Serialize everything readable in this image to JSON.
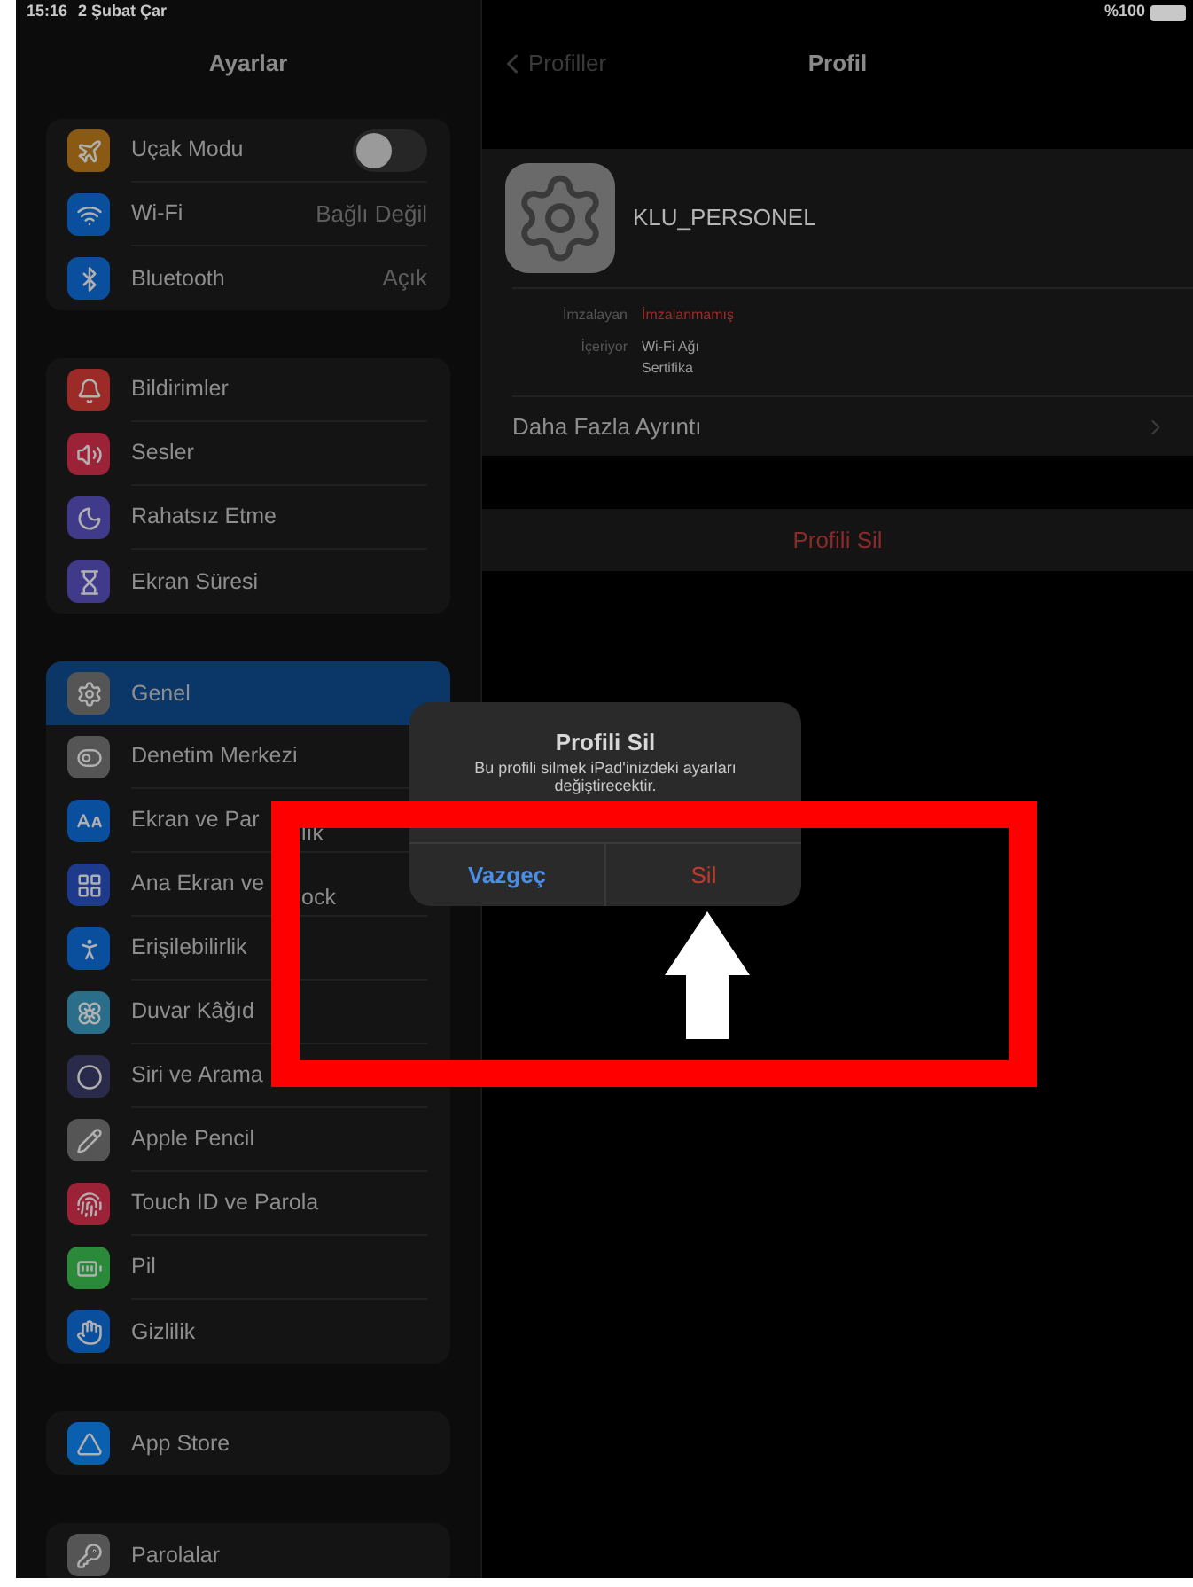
{
  "status_bar": {
    "time": "15:16",
    "date": "2 Şubat Çar",
    "battery": "%100"
  },
  "sidebar": {
    "title": "Ayarlar",
    "groups": [
      {
        "items": [
          {
            "label": "Uçak Modu",
            "kind": "toggle",
            "on": false,
            "selected": false,
            "color": "#8a5a14"
          },
          {
            "label": "Wi-Fi",
            "kind": "value",
            "value": "Bağlı Değil",
            "selected": false,
            "color": "#0a4f9e"
          },
          {
            "label": "Bluetooth",
            "kind": "value",
            "value": "Açık",
            "selected": false,
            "color": "#0a4f9e"
          }
        ]
      },
      {
        "items": [
          {
            "label": "Bildirimler",
            "kind": "plain",
            "selected": false,
            "color": "#9c2a26"
          },
          {
            "label": "Sesler",
            "kind": "plain",
            "selected": false,
            "color": "#9c2238"
          },
          {
            "label": "Rahatsız Etme",
            "kind": "plain",
            "selected": false,
            "color": "#3f3a8a"
          },
          {
            "label": "Ekran Süresi",
            "kind": "plain",
            "selected": false,
            "color": "#3f3a8a"
          }
        ]
      },
      {
        "items": [
          {
            "label": "Genel",
            "kind": "plain",
            "selected": true,
            "color": "#555555"
          },
          {
            "label": "Denetim Merkezi",
            "kind": "plain",
            "selected": false,
            "color": "#555555"
          },
          {
            "label": "Ekran ve Par",
            "label_tail": "lık",
            "kind": "plain",
            "selected": false,
            "color": "#0a4f9e"
          },
          {
            "label": "Ana Ekran ve",
            "label_tail": "ock",
            "kind": "plain",
            "selected": false,
            "color": "#1d3a8c"
          },
          {
            "label": "Erişilebilirlik",
            "kind": "plain",
            "selected": false,
            "color": "#0a4f9e"
          },
          {
            "label": "Duvar Kâğıd",
            "kind": "plain",
            "selected": false,
            "color": "#2a6e8a"
          },
          {
            "label": "Siri ve Arama",
            "kind": "plain",
            "selected": false,
            "color": "#2a2a4a"
          },
          {
            "label": "Apple Pencil",
            "kind": "plain",
            "selected": false,
            "color": "#555555"
          },
          {
            "label": "Touch ID ve Parola",
            "kind": "plain",
            "selected": false,
            "color": "#9c2238"
          },
          {
            "label": "Pil",
            "kind": "plain",
            "selected": false,
            "color": "#2a8a3a"
          },
          {
            "label": "Gizlilik",
            "kind": "plain",
            "selected": false,
            "color": "#0a4f9e"
          }
        ]
      },
      {
        "items": [
          {
            "label": "App Store",
            "kind": "plain",
            "selected": false,
            "color": "#0a5fae"
          }
        ]
      },
      {
        "items": [
          {
            "label": "Parolalar",
            "kind": "plain",
            "selected": false,
            "color": "#555555"
          }
        ]
      }
    ]
  },
  "detail": {
    "back": "Profiller",
    "title": "Profil",
    "profile_name": "KLU_PERSONEL",
    "fields": [
      {
        "label": "İmzalayan",
        "kind": "warning",
        "lines": [
          "İmzalanmamış"
        ]
      },
      {
        "label": "İçeriyor",
        "kind": "normal",
        "lines": [
          "Wi-Fi Ağı",
          "Sertifika"
        ]
      }
    ],
    "more": "Daha Fazla Ayrıntı",
    "remove": "Profili Sil"
  },
  "dialog": {
    "title": "Profili Sil",
    "message": "Bu profili silmek iPad'inizdeki ayarları değiştirecektir.",
    "buttons": [
      {
        "label": "Vazgeç",
        "kind": "cancel"
      },
      {
        "label": "Sil",
        "kind": "destructive"
      }
    ]
  }
}
